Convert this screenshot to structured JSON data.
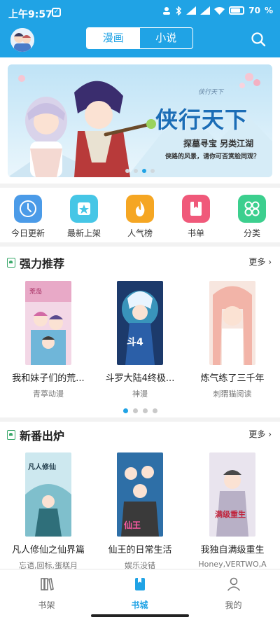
{
  "status": {
    "time": "上午9:57",
    "battery": "70"
  },
  "header": {
    "tabs": [
      {
        "label": "漫画",
        "active": true
      },
      {
        "label": "小说",
        "active": false
      }
    ]
  },
  "banner": {
    "title": "侠行天下",
    "subtitle": "探墓寻宝 另类江湖",
    "desc": "侠路的风景，请你可否赏脸同观？",
    "dots": 4,
    "active_dot": 2
  },
  "quicknav": [
    {
      "label": "今日更新",
      "icon": "clock-icon",
      "color": "#4b9be8"
    },
    {
      "label": "最新上架",
      "icon": "star-tag-icon",
      "color": "#46c6e6"
    },
    {
      "label": "人气榜",
      "icon": "flame-icon",
      "color": "#f5a623"
    },
    {
      "label": "书单",
      "icon": "bookmark-book-icon",
      "color": "#f0597a"
    },
    {
      "label": "分类",
      "icon": "grid-icon",
      "color": "#3ccf8e"
    }
  ],
  "recommend": {
    "title": "强力推荐",
    "more": "更多",
    "items": [
      {
        "title": "我和妹子们的荒...",
        "author": "青葶动漫"
      },
      {
        "title": "斗罗大陆4终极...",
        "author": "神漫"
      },
      {
        "title": "炼气练了三千年",
        "author": "刺猬猫阅读"
      }
    ],
    "pager_dots": 4,
    "pager_active": 0
  },
  "newest": {
    "title": "新番出炉",
    "more": "更多",
    "items": [
      {
        "title": "凡人修仙之仙界篇",
        "author": "忘语,回标,蛋糕月"
      },
      {
        "title": "仙王的日常生活",
        "author": "娱乐没错"
      },
      {
        "title": "我独自满级重生",
        "author": "Honey,VERTWO,A"
      }
    ]
  },
  "bottomnav": [
    {
      "label": "书架",
      "active": false
    },
    {
      "label": "书城",
      "active": true
    },
    {
      "label": "我的",
      "active": false
    }
  ]
}
